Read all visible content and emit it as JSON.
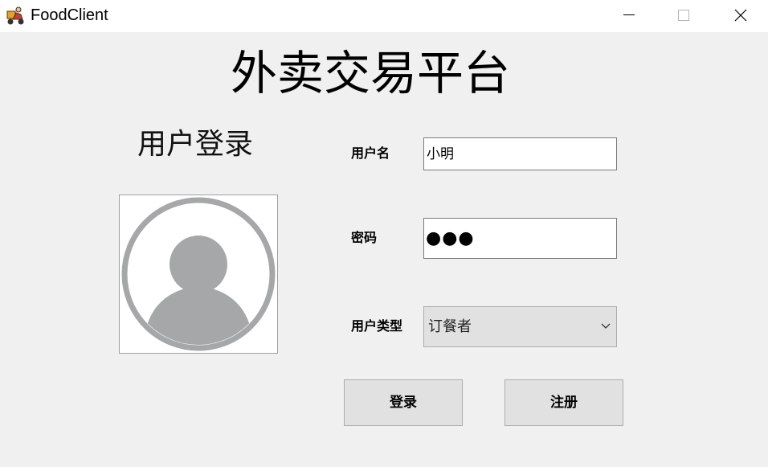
{
  "window": {
    "title": "FoodClient",
    "app_icon": "food-delivery-scooter-icon",
    "controls": [
      "minimize-icon",
      "maximize-icon",
      "close-icon"
    ]
  },
  "header": {
    "title": "外卖交易平台"
  },
  "login_panel": {
    "heading": "用户登录",
    "avatar_icon": "user-avatar-icon"
  },
  "form": {
    "username": {
      "label": "用户名",
      "value": "小明"
    },
    "password": {
      "label": "密码",
      "masked_value": "●●●"
    },
    "user_type": {
      "label": "用户类型",
      "selected": "订餐者"
    }
  },
  "actions": {
    "login_label": "登录",
    "register_label": "注册"
  },
  "colors": {
    "background": "#f0f0f0",
    "titlebar": "#ffffff",
    "button_face": "#e1e1e1",
    "avatar_gray": "#a6a7a9"
  }
}
